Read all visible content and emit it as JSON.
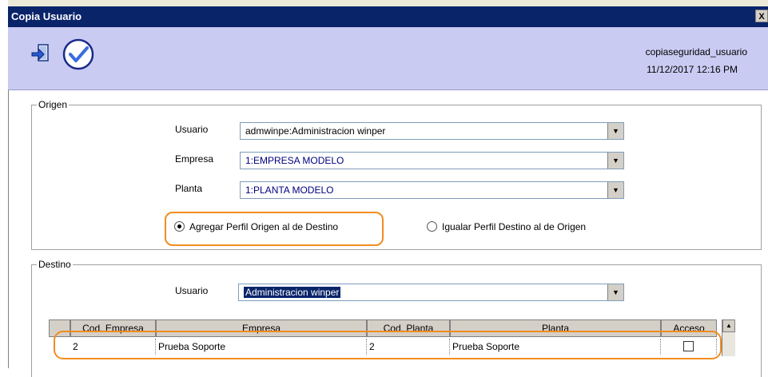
{
  "window": {
    "title": "Copia Usuario",
    "close_label": "X"
  },
  "toolbar": {
    "exit_icon": "exit-icon",
    "confirm_icon": "check-circle-icon",
    "app_name": "copiaseguridad_usuario",
    "datetime": "11/12/2017 12:16 PM"
  },
  "origen": {
    "title": "Origen",
    "usuario_label": "Usuario",
    "usuario_value": "admwinpe:Administracion winper",
    "empresa_label": "Empresa",
    "empresa_value": "1:EMPRESA MODELO",
    "planta_label": "Planta",
    "planta_value": "1:PLANTA MODELO",
    "radio_add": {
      "label": "Agregar Perfil Origen al de Destino",
      "checked": true
    },
    "radio_equal": {
      "label": "Igualar Perfil Destino al de Origen",
      "checked": false
    }
  },
  "destino": {
    "title": "Destino",
    "usuario_label": "Usuario",
    "usuario_value": "Administracion winper"
  },
  "table": {
    "columns": [
      "Cod. Empresa",
      "Empresa",
      "Cod. Planta",
      "Planta",
      "Acceso"
    ],
    "rows": [
      {
        "cod_empresa": "2",
        "empresa": "Prueba Soporte",
        "cod_planta": "2",
        "planta": "Prueba Soporte",
        "acceso": false
      }
    ]
  },
  "colors": {
    "titlebar": "#0a246a",
    "toolbar": "#c9cbf2",
    "highlight": "#f28c20"
  }
}
